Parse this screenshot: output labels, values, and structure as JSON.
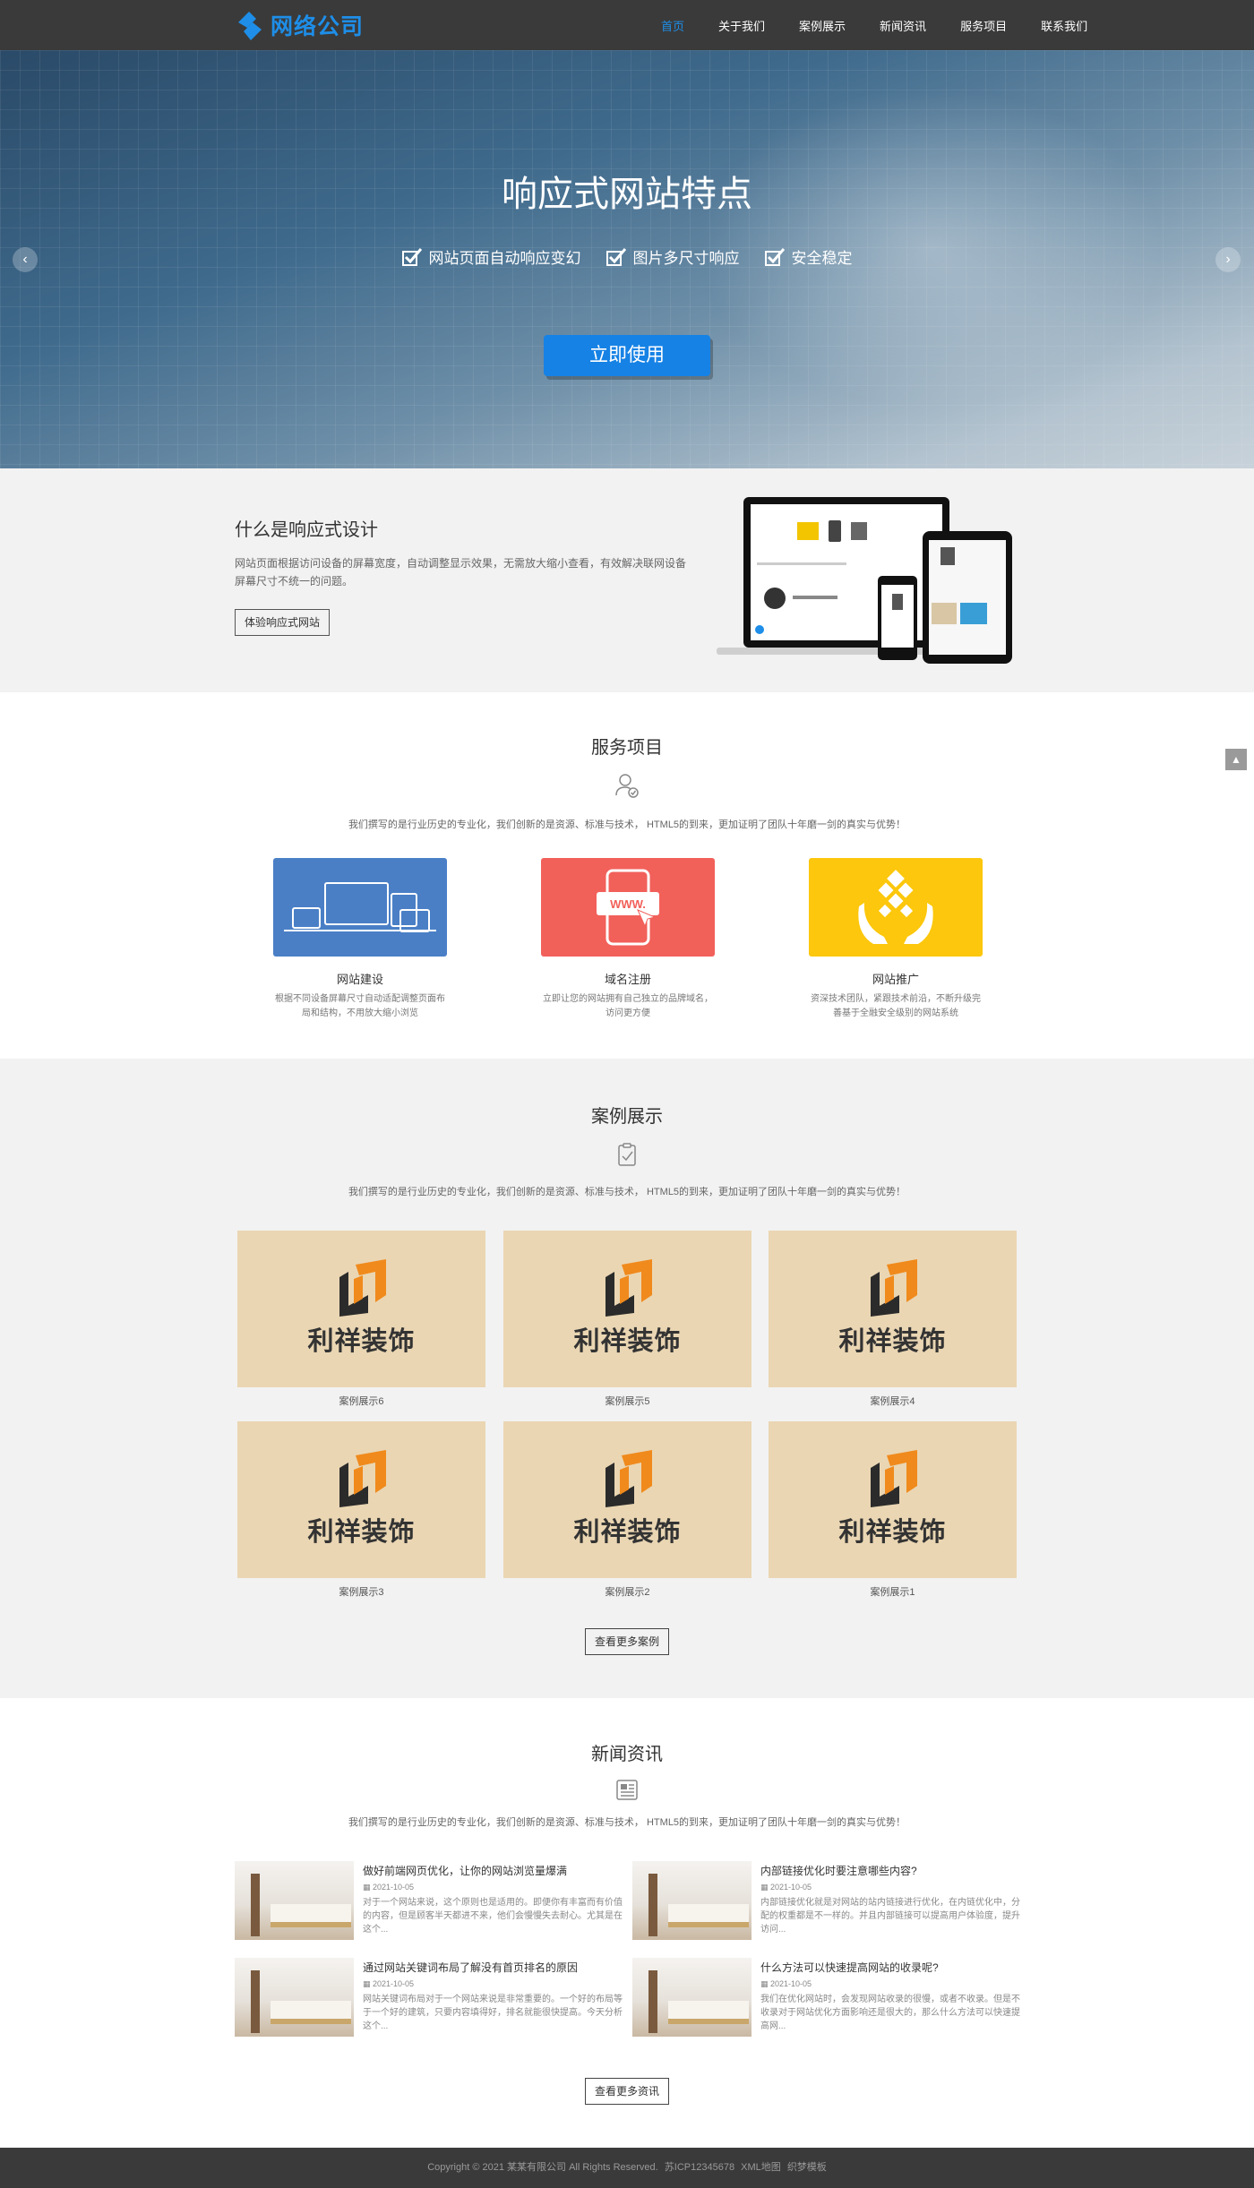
{
  "header": {
    "logo_text": "网络公司",
    "nav": [
      "首页",
      "关于我们",
      "案例展示",
      "新闻资讯",
      "服务项目",
      "联系我们"
    ]
  },
  "hero": {
    "title": "响应式网站特点",
    "features": [
      "网站页面自动响应变幻",
      "图片多尺寸响应",
      "安全稳定"
    ],
    "cta": "立即使用",
    "prev_icon": "chevron-left-icon",
    "next_icon": "chevron-right-icon"
  },
  "responsive": {
    "title": "什么是响应式设计",
    "desc": "网站页面根据访问设备的屏幕宽度，自动调整显示效果，无需放大缩小查看，有效解决联网设备屏幕尺寸不统一的问题。",
    "button": "体验响应式网站"
  },
  "services": {
    "title": "服务项目",
    "subtitle": "我们撰写的是行业历史的专业化，我们创新的是资源、标准与技术， HTML5的到来，更加证明了团队十年磨一剑的真实与优势！",
    "items": [
      {
        "name": "网站建设",
        "desc": "根据不同设备屏幕尺寸自动适配调整页面布局和结构，不用放大缩小浏览",
        "color": "#4a7fc6"
      },
      {
        "name": "域名注册",
        "desc": "立即让您的网站拥有自己独立的品牌域名，访问更方便",
        "color": "#f2605a"
      },
      {
        "name": "网站推广",
        "desc": "资深技术团队，紧跟技术前沿，不断升级完善基于全融安全级别的网站系统",
        "color": "#fcc70c"
      }
    ]
  },
  "cases": {
    "title": "案例展示",
    "subtitle": "我们撰写的是行业历史的专业化，我们创新的是资源、标准与技术， HTML5的到来，更加证明了团队十年磨一剑的真实与优势！",
    "brand": "利祥装饰",
    "items": [
      "案例展示6",
      "案例展示5",
      "案例展示4",
      "案例展示3",
      "案例展示2",
      "案例展示1"
    ],
    "more": "查看更多案例"
  },
  "news": {
    "title": "新闻资讯",
    "subtitle": "我们撰写的是行业历史的专业化，我们创新的是资源、标准与技术， HTML5的到来，更加证明了团队十年磨一剑的真实与优势！",
    "items": [
      {
        "title": "做好前端网页优化，让你的网站浏览量爆满",
        "date": "2021-10-05",
        "excerpt": "对于一个网站来说，这个原则也是适用的。即便你有丰富而有价值的内容，但是顾客半天都进不来，他们会慢慢失去耐心。尤其是在这个..."
      },
      {
        "title": "内部链接优化时要注意哪些内容?",
        "date": "2021-10-05",
        "excerpt": "内部链接优化就是对网站的站内链接进行优化，在内链优化中，分配的权重都是不一样的。并且内部链接可以提高用户体验度，提升访问..."
      },
      {
        "title": "通过网站关键词布局了解没有首页排名的原因",
        "date": "2021-10-05",
        "excerpt": "网站关键词布局对于一个网站来说是非常重要的。一个好的布局等于一个好的建筑，只要内容填得好，排名就能很快提高。今天分析这个..."
      },
      {
        "title": "什么方法可以快速提高网站的收录呢?",
        "date": "2021-10-05",
        "excerpt": "我们在优化网站时，会发现网站收录的很慢，或者不收录。但是不收录对于网站优化方面影响还是很大的，那么什么方法可以快速提高网..."
      }
    ],
    "more": "查看更多资讯"
  },
  "footer": {
    "copyright": "Copyright © 2021 某某有限公司 All Rights Reserved.",
    "icp": "苏ICP12345678",
    "links": [
      "XML地图",
      "织梦模板"
    ]
  },
  "back_to_top_icon": "arrow-up-icon"
}
